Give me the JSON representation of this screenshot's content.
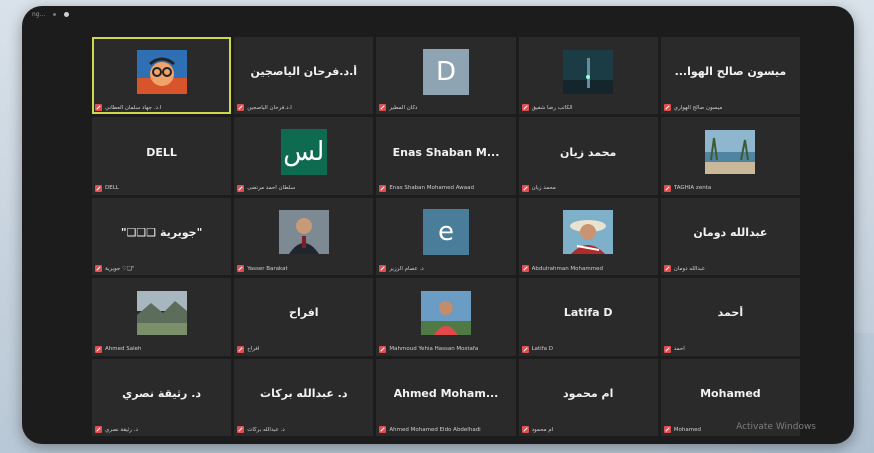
{
  "window": {
    "title": "ng..."
  },
  "watermark": "Activate Windows",
  "colors": {
    "active_border": "#cbd94a",
    "muted_red": "#e04f4f",
    "tile": "#2a2a2a"
  },
  "tiles": [
    {
      "type": "photo",
      "photo": "cartoon-avatar",
      "label": "أ.د. جهاد سلمان العطاني",
      "active": true
    },
    {
      "type": "name",
      "name": "أ.د.فرحان الياصجين",
      "label": "أ.د.فرحان الياصجين"
    },
    {
      "type": "letter",
      "letter": "D",
      "avatar_color": "#8ea4b3",
      "label": "دكان المطير"
    },
    {
      "type": "photo",
      "photo": "tower",
      "label": "الكاتب رضا شفيق"
    },
    {
      "type": "name",
      "name": "...ميسون صالح الهوا",
      "label": "ميسون صالح الهواري"
    },
    {
      "type": "name",
      "name": "DELL",
      "label": "DELL"
    },
    {
      "type": "letter",
      "letter": "لس",
      "avatar_color": "#0e6b4f",
      "label": "سلطان أحمد مرتضى"
    },
    {
      "type": "name",
      "name": "Enas Shaban M...",
      "label": "Enas Shaban Mohamed Awaad"
    },
    {
      "type": "name",
      "name": "محمد زيان",
      "label": "محمد زيان"
    },
    {
      "type": "photo",
      "photo": "beach",
      "label": "TAGHIA zenta"
    },
    {
      "type": "name",
      "name": "\"❑❑❑ جويرية\"",
      "label": "جويرية ♡❑\""
    },
    {
      "type": "photo",
      "photo": "man-suit",
      "label": "Yasser Barakat"
    },
    {
      "type": "letter",
      "letter": "e",
      "avatar_color": "#4a7d9a",
      "label": "د. عصام الرزير"
    },
    {
      "type": "photo",
      "photo": "hat",
      "label": "Abdulrahman Mohammed"
    },
    {
      "type": "name",
      "name": "عبدالله دومان",
      "label": "عبدالله دومان"
    },
    {
      "type": "photo",
      "photo": "landscape",
      "label": "Ahmed Saleh"
    },
    {
      "type": "name",
      "name": "افراح",
      "label": "افراح"
    },
    {
      "type": "photo",
      "photo": "man-outdoor",
      "label": "Mahmoud Yehia Hassan Mostafa"
    },
    {
      "type": "name",
      "name": "Latifa D",
      "label": "Latifa D"
    },
    {
      "type": "name",
      "name": "أحمد",
      "label": "أحمد"
    },
    {
      "type": "name",
      "name": "د. رثيقة نصري",
      "label": "د. رثيقة نصري"
    },
    {
      "type": "name",
      "name": "د. عبدالله بركات",
      "label": "د. عبدالله بركات"
    },
    {
      "type": "name",
      "name": "Ahmed Moham...",
      "label": "Ahmed Mohamed Eldo Abdelhadi"
    },
    {
      "type": "name",
      "name": "ام محمود",
      "label": "ام محمود"
    },
    {
      "type": "name",
      "name": "Mohamed",
      "label": "Mohamed"
    }
  ]
}
